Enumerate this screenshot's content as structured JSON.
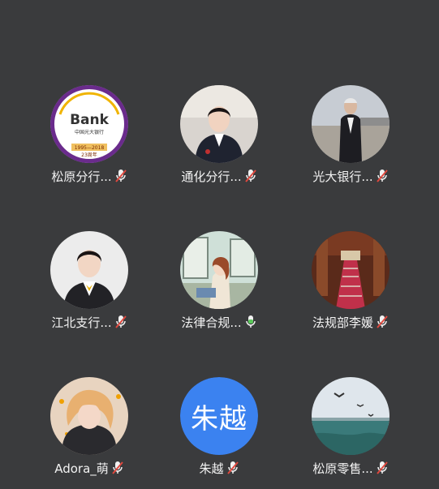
{
  "participants": [
    {
      "name": "松原分行...",
      "mic": "muted",
      "avatar": "bank-logo-image",
      "logo": {
        "brand": "Bank",
        "cn": "中国光大银行",
        "years": "1995—2018",
        "anniv": "23周年"
      }
    },
    {
      "name": "通化分行...",
      "mic": "muted",
      "avatar": "woman-in-suit-photo"
    },
    {
      "name": "光大银行...",
      "mic": "muted",
      "avatar": "man-standing-photo"
    },
    {
      "name": "江北支行...",
      "mic": "muted",
      "avatar": "woman-uniform-photo"
    },
    {
      "name": "法律合规...",
      "mic": "active",
      "avatar": "illustrated-girl-image"
    },
    {
      "name": "法规部李媛",
      "mic": "muted",
      "avatar": "staircase-photo"
    },
    {
      "name": "Adora_萌",
      "mic": "muted",
      "avatar": "girl-portrait-photo"
    },
    {
      "name": "朱越",
      "mic": "muted",
      "avatar_text": "朱越"
    },
    {
      "name": "松原零售...",
      "mic": "muted",
      "avatar": "sea-birds-photo"
    }
  ],
  "colors": {
    "background": "#3a3b3d",
    "avatar_blue": "#3b82f0",
    "mic_active": "#5ac85a",
    "mic_muted_slash": "#e0483e"
  }
}
